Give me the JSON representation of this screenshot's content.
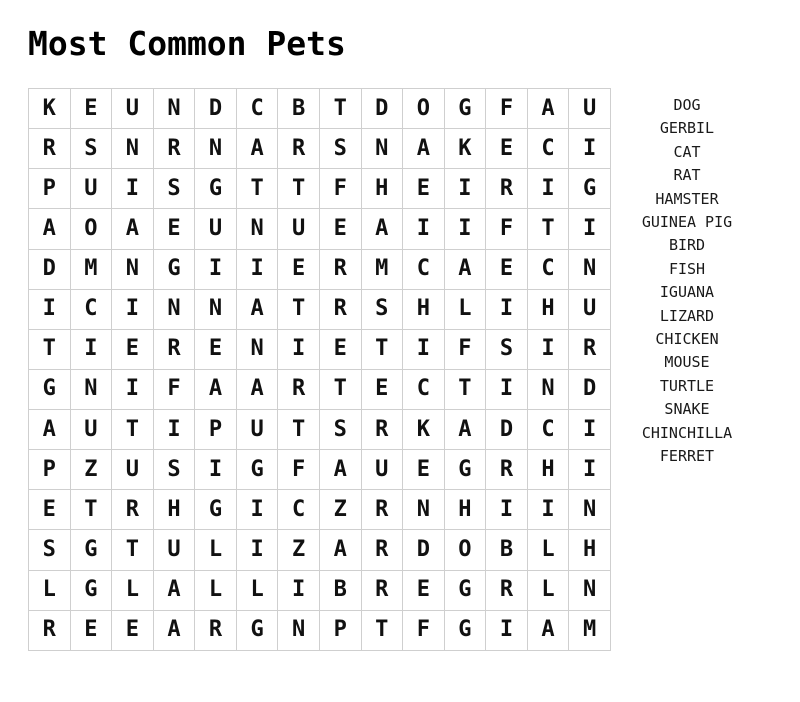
{
  "puzzle": {
    "title": "Most Common Pets",
    "theme_color": "#000000",
    "grid_line_color": "#cfcfcf",
    "background_color": "#ffffff",
    "rows": 14,
    "columns": 14,
    "grid": [
      [
        "K",
        "E",
        "U",
        "N",
        "D",
        "C",
        "B",
        "T",
        "D",
        "O",
        "G",
        "F",
        "A",
        "U"
      ],
      [
        "R",
        "S",
        "N",
        "R",
        "N",
        "A",
        "R",
        "S",
        "N",
        "A",
        "K",
        "E",
        "C",
        "I"
      ],
      [
        "P",
        "U",
        "I",
        "S",
        "G",
        "T",
        "T",
        "F",
        "H",
        "E",
        "I",
        "R",
        "I",
        "G"
      ],
      [
        "A",
        "O",
        "A",
        "E",
        "U",
        "N",
        "U",
        "E",
        "A",
        "I",
        "I",
        "F",
        "T",
        "I"
      ],
      [
        "D",
        "M",
        "N",
        "G",
        "I",
        "I",
        "E",
        "R",
        "M",
        "C",
        "A",
        "E",
        "C",
        "N"
      ],
      [
        "I",
        "C",
        "I",
        "N",
        "N",
        "A",
        "T",
        "R",
        "S",
        "H",
        "L",
        "I",
        "H",
        "U"
      ],
      [
        "T",
        "I",
        "E",
        "R",
        "E",
        "N",
        "I",
        "E",
        "T",
        "I",
        "F",
        "S",
        "I",
        "R"
      ],
      [
        "G",
        "N",
        "I",
        "F",
        "A",
        "A",
        "R",
        "T",
        "E",
        "C",
        "T",
        "I",
        "N",
        "D"
      ],
      [
        "A",
        "U",
        "T",
        "I",
        "P",
        "U",
        "T",
        "S",
        "R",
        "K",
        "A",
        "D",
        "C",
        "I"
      ],
      [
        "P",
        "Z",
        "U",
        "S",
        "I",
        "G",
        "F",
        "A",
        "U",
        "E",
        "G",
        "R",
        "H",
        "I"
      ],
      [
        "E",
        "T",
        "R",
        "H",
        "G",
        "I",
        "C",
        "Z",
        "R",
        "N",
        "H",
        "I",
        "I",
        "N"
      ],
      [
        "S",
        "G",
        "T",
        "U",
        "L",
        "I",
        "Z",
        "A",
        "R",
        "D",
        "O",
        "B",
        "L",
        "H"
      ],
      [
        "L",
        "G",
        "L",
        "A",
        "L",
        "L",
        "I",
        "B",
        "R",
        "E",
        "G",
        "R",
        "L",
        "N"
      ],
      [
        "R",
        "E",
        "E",
        "A",
        "R",
        "G",
        "N",
        "P",
        "T",
        "F",
        "G",
        "I",
        "A",
        "M"
      ]
    ],
    "words": [
      "DOG",
      "GERBIL",
      "CAT",
      "RAT",
      "HAMSTER",
      "GUINEA PIG",
      "BIRD",
      "FISH",
      "IGUANA",
      "LIZARD",
      "CHICKEN",
      "MOUSE",
      "TURTLE",
      "SNAKE",
      "CHINCHILLA",
      "FERRET"
    ]
  }
}
